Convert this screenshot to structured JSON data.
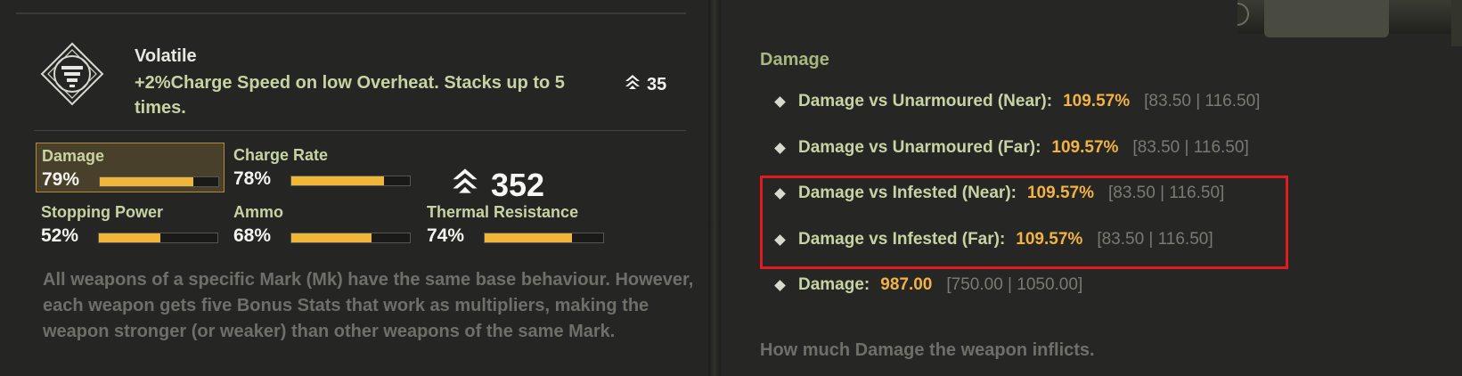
{
  "perk": {
    "name": "Volatile",
    "description": "+2%Charge Speed on low Overheat. Stacks up to 5 times.",
    "level": "35",
    "icon": "volatile-perk-icon"
  },
  "stats": [
    {
      "label": "Damage",
      "value": "79%",
      "fill": 0.79,
      "selected": true
    },
    {
      "label": "Charge Rate",
      "value": "78%",
      "fill": 0.78,
      "selected": false
    },
    {
      "label": "Stopping Power",
      "value": "52%",
      "fill": 0.52,
      "selected": false
    },
    {
      "label": "Ammo",
      "value": "68%",
      "fill": 0.68,
      "selected": false
    },
    {
      "label": "Thermal Resistance",
      "value": "74%",
      "fill": 0.74,
      "selected": false
    }
  ],
  "total_power": "352",
  "explanation": "All weapons of a specific Mark (Mk) have the same base behaviour. However, each weapon gets five Bonus Stats that work as multipliers, making the weapon stronger (or weaker) than other weapons of the same Mark.",
  "damage_section": {
    "title": "Damage",
    "rows": [
      {
        "label": "Damage vs Unarmoured (Near):",
        "value": "109.57%",
        "range": "[83.50 | 116.50]"
      },
      {
        "label": "Damage vs Unarmoured (Far):",
        "value": "109.57%",
        "range": "[83.50 | 116.50]"
      },
      {
        "label": "Damage vs Infested (Near):",
        "value": "109.57%",
        "range": "[83.50 | 116.50]"
      },
      {
        "label": "Damage vs Infested (Far):",
        "value": "109.57%",
        "range": "[83.50 | 116.50]"
      },
      {
        "label": "Damage:",
        "value": "987.00",
        "range": "[750.00 | 1050.00]"
      }
    ],
    "description": "How much Damage the weapon inflicts."
  },
  "colors": {
    "accent": "#f0b63a",
    "label": "#c8d3a4",
    "highlight": "#e01c22"
  }
}
